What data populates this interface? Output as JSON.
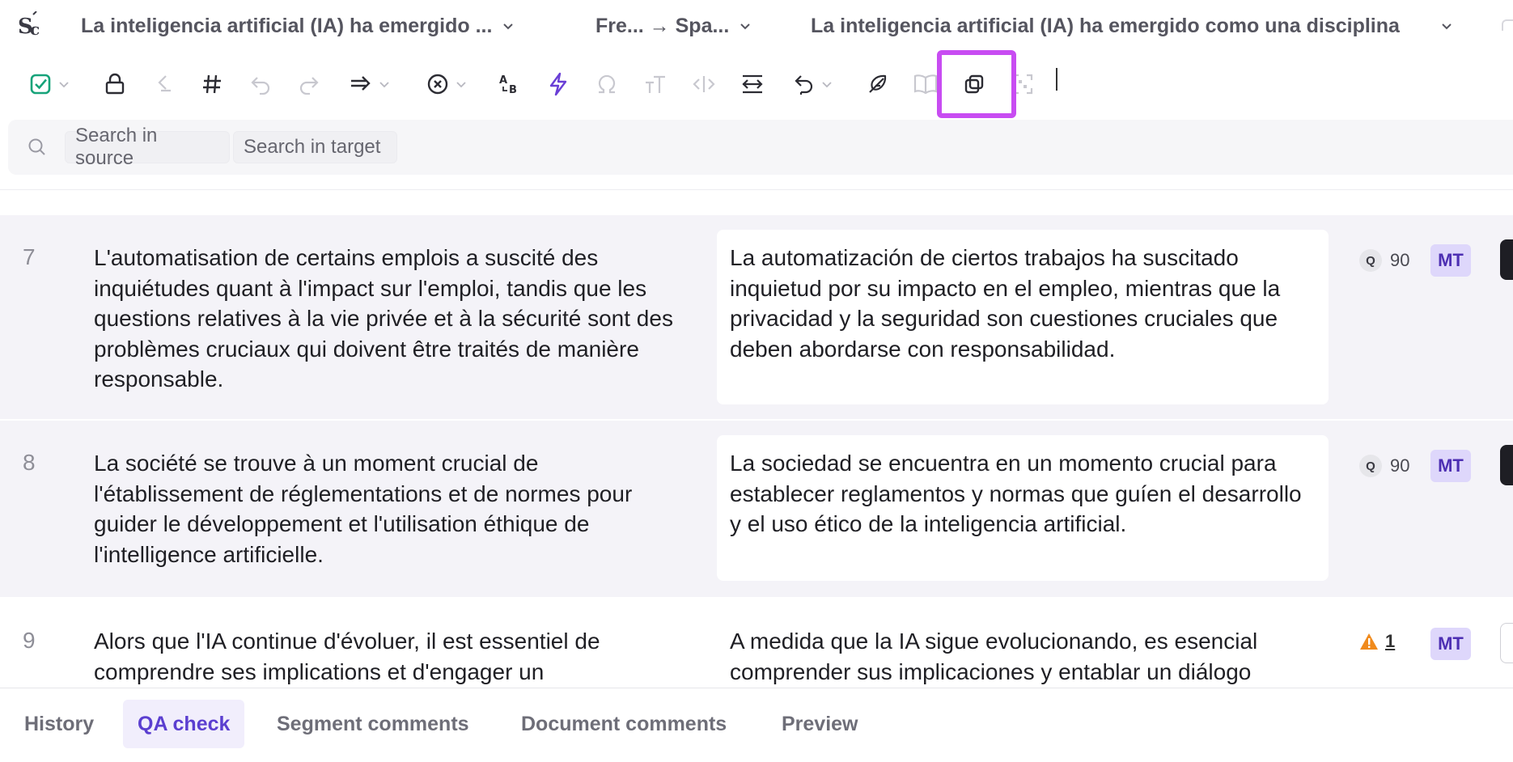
{
  "topbar": {
    "logo_icon": "sc-logo-icon",
    "document_title": "La inteligencia artificial (IA) ha emergido ...",
    "language_pair": "Fre... → Spa...",
    "segment_title": "La inteligencia artificial (IA) ha emergido como una disciplina"
  },
  "toolbar": {
    "items": [
      "confirm-check-icon",
      "lock-icon",
      "split-icon",
      "hash-icon",
      "undo-icon",
      "redo-icon",
      "copy-source-icon",
      "clear-icon",
      "case-icon",
      "lightning-icon",
      "omega-icon",
      "text-size-icon",
      "tags-icon",
      "wrap-icon",
      "revert-icon",
      "feather-icon",
      "book-icon",
      "duplicate-icon",
      "qr-icon"
    ],
    "highlight_color": "#c84cf2"
  },
  "search": {
    "source_placeholder": "Search in source",
    "target_placeholder": "Search in target"
  },
  "segments": [
    {
      "number": "7",
      "source": "L'automatisation de certains emplois a suscité des inquiétudes quant à l'impact sur l'emploi, tandis que les questions relatives à la vie privée et à la sécurité sont des problèmes cruciaux qui doivent être traités de manière responsable.",
      "target": "La automatización de ciertos trabajos ha suscitado inquietud por su impacto en el empleo, mientras que la privacidad y la seguridad son cuestiones cruciales que deben abordarse con responsabilidad.",
      "q_label": "Q",
      "score": "90",
      "origin": "MT"
    },
    {
      "number": "8",
      "source": "La société se trouve à un moment crucial de l'établissement de réglementations et de normes pour guider le développement et l'utilisation éthique de l'intelligence artificielle.",
      "target": "La sociedad se encuentra en un momento crucial para establecer reglamentos y normas que guíen el desarrollo y el uso ético de la inteligencia artificial.",
      "q_label": "Q",
      "score": "90",
      "origin": "MT"
    },
    {
      "number": "9",
      "source": "Alors que l'IA continue d'évoluer, il est essentiel de comprendre ses implications et d'engager un",
      "target": "A medida que la IA sigue evolucionando, es esencial comprender sus implicaciones y entablar un diálogo",
      "warning_count": "1",
      "origin": "MT"
    }
  ],
  "tabs": [
    "History",
    "QA check",
    "Segment comments",
    "Document comments",
    "Preview"
  ],
  "active_tab": "QA check",
  "colors": {
    "accent": "#5b3fd0",
    "mt_badge_bg": "#ded7fb",
    "warning": "#f08a1c"
  }
}
